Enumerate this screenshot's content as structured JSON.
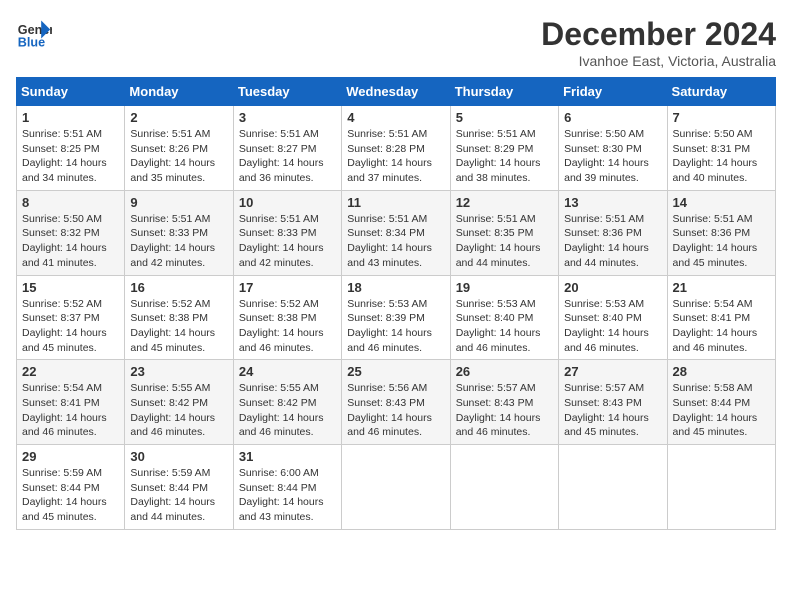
{
  "header": {
    "logo_line1": "General",
    "logo_line2": "Blue",
    "month_title": "December 2024",
    "location": "Ivanhoe East, Victoria, Australia"
  },
  "weekdays": [
    "Sunday",
    "Monday",
    "Tuesday",
    "Wednesday",
    "Thursday",
    "Friday",
    "Saturday"
  ],
  "weeks": [
    [
      {
        "day": "1",
        "sunrise": "5:51 AM",
        "sunset": "8:25 PM",
        "daylight": "14 hours and 34 minutes."
      },
      {
        "day": "2",
        "sunrise": "5:51 AM",
        "sunset": "8:26 PM",
        "daylight": "14 hours and 35 minutes."
      },
      {
        "day": "3",
        "sunrise": "5:51 AM",
        "sunset": "8:27 PM",
        "daylight": "14 hours and 36 minutes."
      },
      {
        "day": "4",
        "sunrise": "5:51 AM",
        "sunset": "8:28 PM",
        "daylight": "14 hours and 37 minutes."
      },
      {
        "day": "5",
        "sunrise": "5:51 AM",
        "sunset": "8:29 PM",
        "daylight": "14 hours and 38 minutes."
      },
      {
        "day": "6",
        "sunrise": "5:50 AM",
        "sunset": "8:30 PM",
        "daylight": "14 hours and 39 minutes."
      },
      {
        "day": "7",
        "sunrise": "5:50 AM",
        "sunset": "8:31 PM",
        "daylight": "14 hours and 40 minutes."
      }
    ],
    [
      {
        "day": "8",
        "sunrise": "5:50 AM",
        "sunset": "8:32 PM",
        "daylight": "14 hours and 41 minutes."
      },
      {
        "day": "9",
        "sunrise": "5:51 AM",
        "sunset": "8:33 PM",
        "daylight": "14 hours and 42 minutes."
      },
      {
        "day": "10",
        "sunrise": "5:51 AM",
        "sunset": "8:33 PM",
        "daylight": "14 hours and 42 minutes."
      },
      {
        "day": "11",
        "sunrise": "5:51 AM",
        "sunset": "8:34 PM",
        "daylight": "14 hours and 43 minutes."
      },
      {
        "day": "12",
        "sunrise": "5:51 AM",
        "sunset": "8:35 PM",
        "daylight": "14 hours and 44 minutes."
      },
      {
        "day": "13",
        "sunrise": "5:51 AM",
        "sunset": "8:36 PM",
        "daylight": "14 hours and 44 minutes."
      },
      {
        "day": "14",
        "sunrise": "5:51 AM",
        "sunset": "8:36 PM",
        "daylight": "14 hours and 45 minutes."
      }
    ],
    [
      {
        "day": "15",
        "sunrise": "5:52 AM",
        "sunset": "8:37 PM",
        "daylight": "14 hours and 45 minutes."
      },
      {
        "day": "16",
        "sunrise": "5:52 AM",
        "sunset": "8:38 PM",
        "daylight": "14 hours and 45 minutes."
      },
      {
        "day": "17",
        "sunrise": "5:52 AM",
        "sunset": "8:38 PM",
        "daylight": "14 hours and 46 minutes."
      },
      {
        "day": "18",
        "sunrise": "5:53 AM",
        "sunset": "8:39 PM",
        "daylight": "14 hours and 46 minutes."
      },
      {
        "day": "19",
        "sunrise": "5:53 AM",
        "sunset": "8:40 PM",
        "daylight": "14 hours and 46 minutes."
      },
      {
        "day": "20",
        "sunrise": "5:53 AM",
        "sunset": "8:40 PM",
        "daylight": "14 hours and 46 minutes."
      },
      {
        "day": "21",
        "sunrise": "5:54 AM",
        "sunset": "8:41 PM",
        "daylight": "14 hours and 46 minutes."
      }
    ],
    [
      {
        "day": "22",
        "sunrise": "5:54 AM",
        "sunset": "8:41 PM",
        "daylight": "14 hours and 46 minutes."
      },
      {
        "day": "23",
        "sunrise": "5:55 AM",
        "sunset": "8:42 PM",
        "daylight": "14 hours and 46 minutes."
      },
      {
        "day": "24",
        "sunrise": "5:55 AM",
        "sunset": "8:42 PM",
        "daylight": "14 hours and 46 minutes."
      },
      {
        "day": "25",
        "sunrise": "5:56 AM",
        "sunset": "8:43 PM",
        "daylight": "14 hours and 46 minutes."
      },
      {
        "day": "26",
        "sunrise": "5:57 AM",
        "sunset": "8:43 PM",
        "daylight": "14 hours and 46 minutes."
      },
      {
        "day": "27",
        "sunrise": "5:57 AM",
        "sunset": "8:43 PM",
        "daylight": "14 hours and 45 minutes."
      },
      {
        "day": "28",
        "sunrise": "5:58 AM",
        "sunset": "8:44 PM",
        "daylight": "14 hours and 45 minutes."
      }
    ],
    [
      {
        "day": "29",
        "sunrise": "5:59 AM",
        "sunset": "8:44 PM",
        "daylight": "14 hours and 45 minutes."
      },
      {
        "day": "30",
        "sunrise": "5:59 AM",
        "sunset": "8:44 PM",
        "daylight": "14 hours and 44 minutes."
      },
      {
        "day": "31",
        "sunrise": "6:00 AM",
        "sunset": "8:44 PM",
        "daylight": "14 hours and 43 minutes."
      },
      null,
      null,
      null,
      null
    ]
  ]
}
